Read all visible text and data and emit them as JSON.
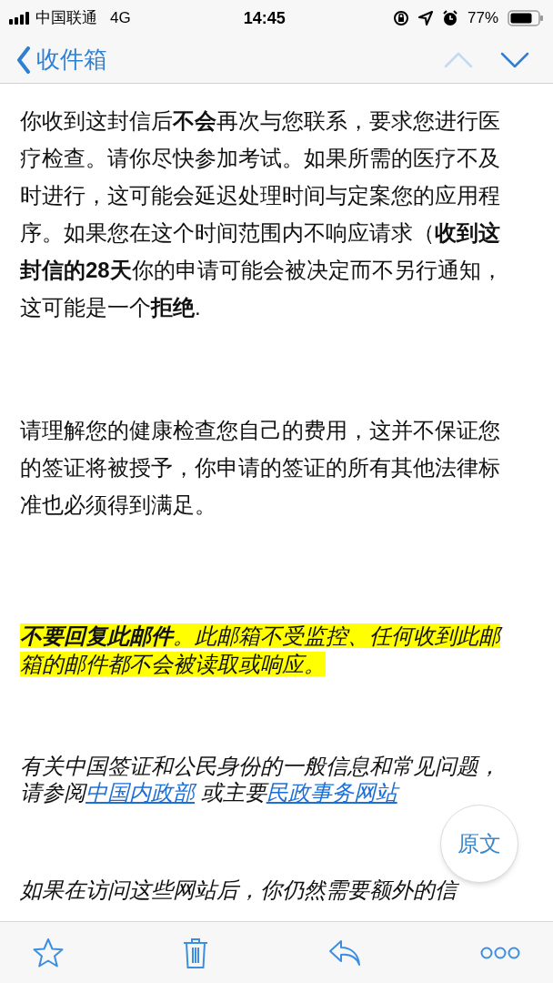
{
  "status_bar": {
    "carrier": "中国联通",
    "network": "4G",
    "time": "14:45",
    "battery_percent": "77%"
  },
  "nav_bar": {
    "back_label": "收件箱",
    "arrows": [
      {
        "kind": "up",
        "disabled": true
      },
      {
        "kind": "down",
        "disabled": false
      }
    ]
  },
  "message": {
    "paragraphs": [
      {
        "italic": false,
        "highlighted": false,
        "segments": [
          {
            "kind": "text",
            "text": "你收到这封信后**不会**再次与您联系，要求您进行医疗检查。请你尽快参加考试。如果所需的医疗不及时进行，这可能会延迟处理时间与定案您的应用程序。如果您在这个时间范围内不响应请求（**收到这封信的28天**你的申请可能会被决定而不另行通知，这可能是一个**拒绝**."
          }
        ]
      },
      {
        "italic": false,
        "highlighted": false,
        "segments": [
          {
            "kind": "text",
            "text": "请理解您的健康检查您自己的费用，这并不保证您的签证将被授予，你申请的签证的所有其他法律标准也必须得到满足。"
          }
        ]
      },
      {
        "italic": true,
        "highlighted": true,
        "segments": [
          {
            "kind": "text",
            "text": "**不要回复此邮件**。此邮箱不受监控、任何收到此邮箱的邮件都不会被读取或响应。"
          }
        ]
      },
      {
        "italic": true,
        "highlighted": false,
        "segments": [
          {
            "kind": "text",
            "text": "有关中国签证和公民身份的一般信息和常见问题，请参阅"
          },
          {
            "kind": "link",
            "text": "中国内政部"
          },
          {
            "kind": "text",
            "text": " 或主要"
          },
          {
            "kind": "link",
            "text": "民政事务网站"
          }
        ]
      },
      {
        "italic": true,
        "highlighted": false,
        "segments": [
          {
            "kind": "text",
            "text": "如果在访问这些网站后，你仍然需要额外的信"
          }
        ]
      }
    ]
  },
  "original_button": {
    "label": "原文"
  },
  "toolbar": {
    "buttons": [
      {
        "kind": "star"
      },
      {
        "kind": "trash"
      },
      {
        "kind": "reply"
      },
      {
        "kind": "more"
      }
    ]
  }
}
